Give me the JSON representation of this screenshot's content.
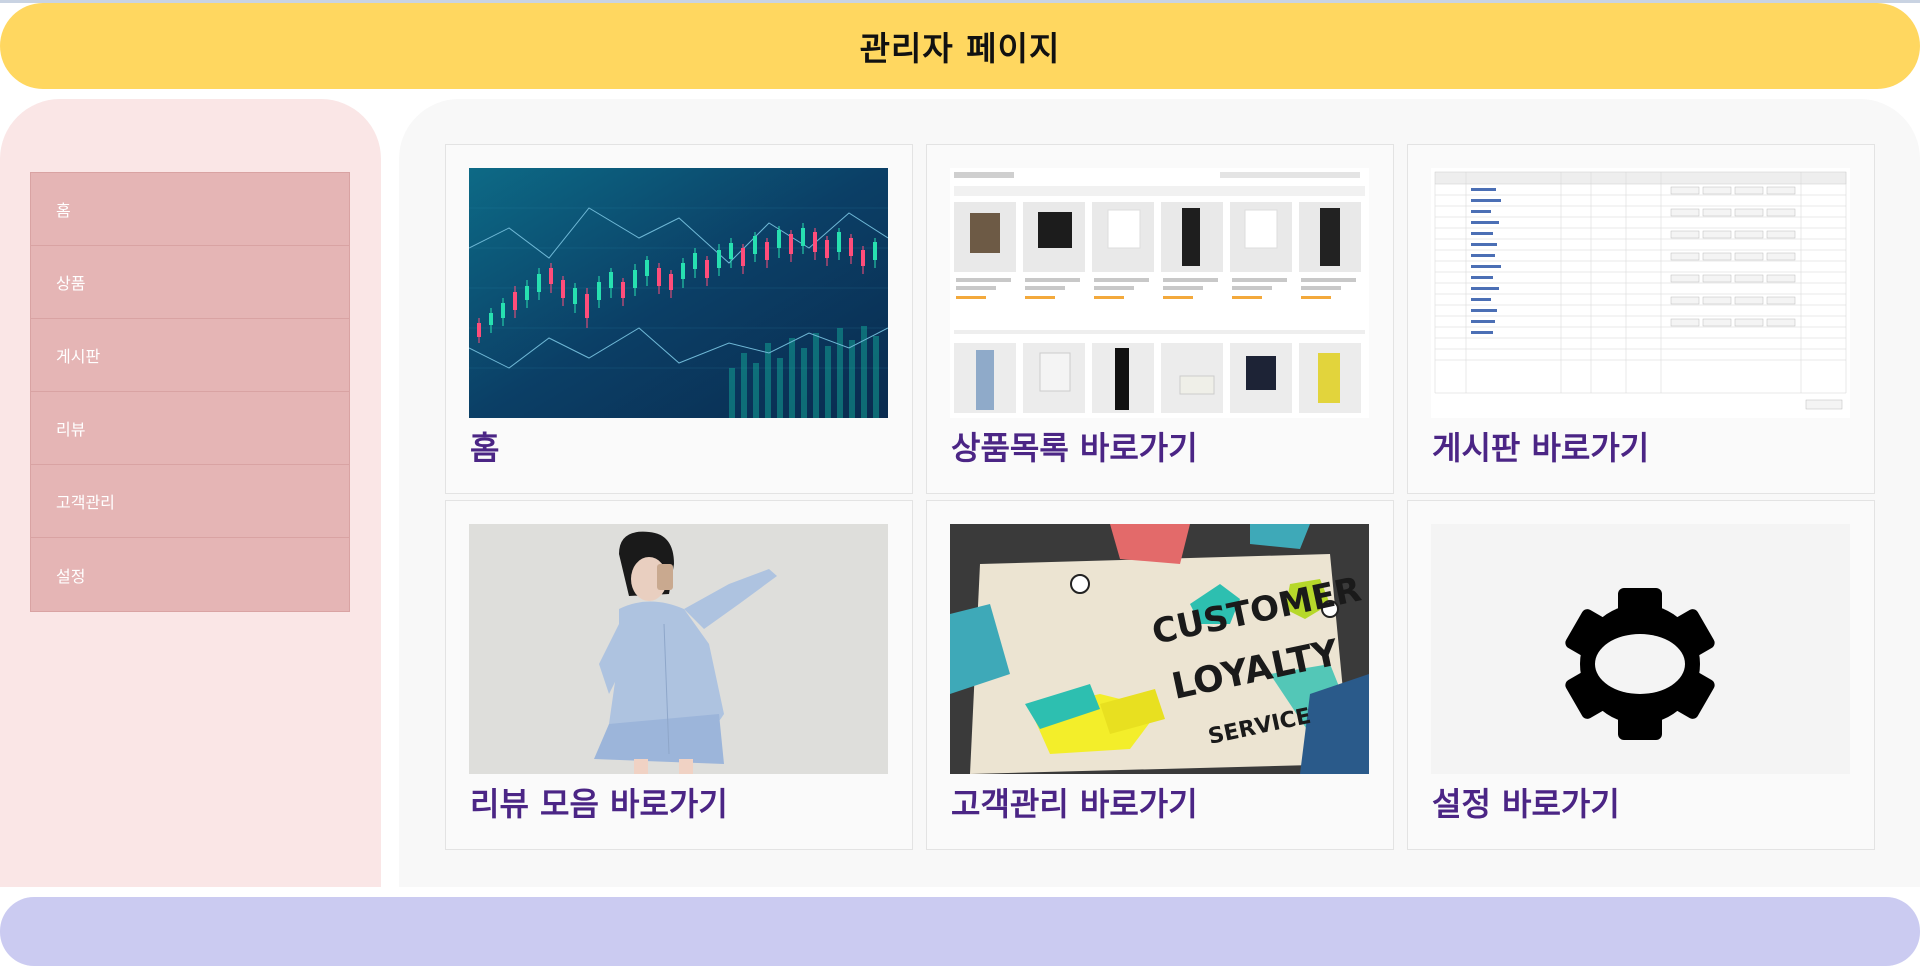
{
  "header": {
    "title": "관리자 페이지"
  },
  "sidebar": {
    "items": [
      {
        "label": "홈"
      },
      {
        "label": "상품"
      },
      {
        "label": "게시판"
      },
      {
        "label": "리뷰"
      },
      {
        "label": "고객관리"
      },
      {
        "label": "설정"
      }
    ]
  },
  "cards": [
    {
      "label": "홈",
      "image": "stock-chart-image"
    },
    {
      "label": "상품목록 바로가기",
      "image": "product-list-screenshot"
    },
    {
      "label": "게시판 바로가기",
      "image": "board-table-screenshot"
    },
    {
      "label": "리뷰 모음 바로가기",
      "image": "review-model-photo"
    },
    {
      "label": "고객관리 바로가기",
      "image": "customer-loyalty-image"
    },
    {
      "label": "설정 바로가기",
      "image": "gear-icon"
    }
  ],
  "colors": {
    "header": "#ffd760",
    "sidebar": "#fae6e6",
    "menu_item": "#e5b5b5",
    "card_label": "#4b2585",
    "footer": "#cbcbf1"
  }
}
